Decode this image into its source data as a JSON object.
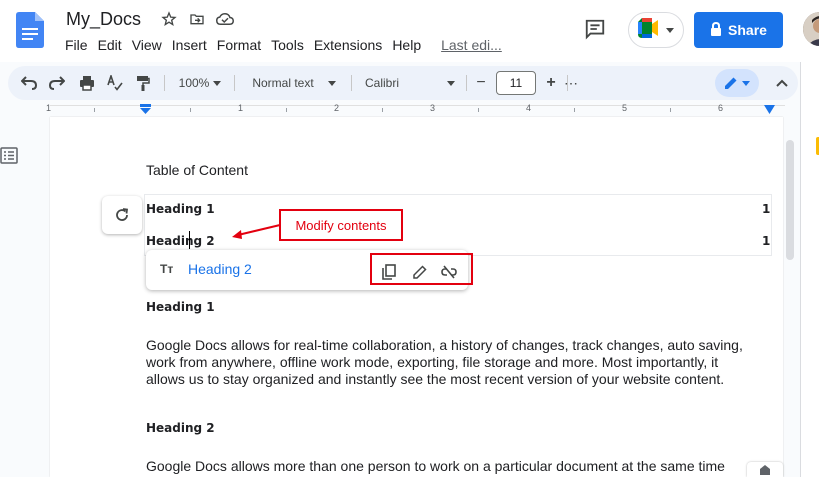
{
  "header": {
    "doc_title": "My_Docs",
    "menu": [
      "File",
      "Edit",
      "View",
      "Insert",
      "Format",
      "Tools",
      "Extensions",
      "Help"
    ],
    "last_edit": "Last edi...",
    "share_label": "Share",
    "share_color": "#1a73e8"
  },
  "toolbar": {
    "zoom": "100%",
    "style": "Normal text",
    "font": "Calibri",
    "font_size": "11",
    "minus": "−",
    "plus": "+",
    "more": "⋯"
  },
  "ruler": {
    "numbers": [
      "1",
      "1",
      "2",
      "3",
      "4",
      "5",
      "6"
    ]
  },
  "document": {
    "toc_title": "Table of Content",
    "toc_entries": [
      {
        "label": "Heading 1",
        "page": "1"
      },
      {
        "label": "Heading 2",
        "page": "1"
      }
    ],
    "heading_1": "Heading 1",
    "para_1": "Google Docs allows for real-time collaboration, a history of changes, track changes, auto saving, work from anywhere, offline work mode, exporting, file storage and more. Most importantly, it allows us to stay organized and instantly see the most recent version of your website content.",
    "heading_2": "Heading 2",
    "para_2": "Google Docs allows more than one person to work on a particular document at the same time"
  },
  "link_popup": {
    "icon_text": "Tт",
    "link_label": "Heading 2"
  },
  "annotation": {
    "callout_text": "Modify contents",
    "color": "#e3000f"
  },
  "icons": [
    "docs-logo-icon",
    "star-icon",
    "move-folder-icon",
    "cloud-saved-icon",
    "comment-icon",
    "meet-icon",
    "lock-icon",
    "undo-icon",
    "redo-icon",
    "print-icon",
    "spellcheck-icon",
    "paint-format-icon",
    "refresh-icon",
    "copy-icon",
    "edit-pencil-icon",
    "unlink-icon",
    "outline-icon"
  ]
}
